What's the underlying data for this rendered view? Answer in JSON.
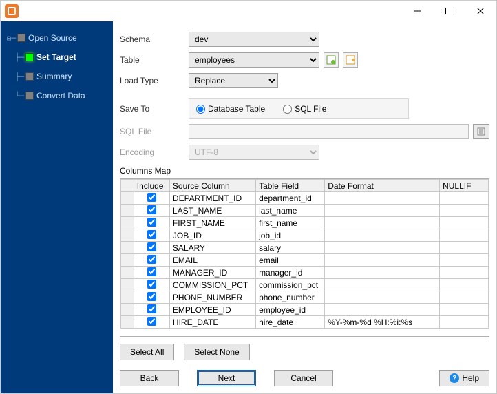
{
  "sidebar": {
    "items": [
      {
        "label": "Open Source",
        "active": false
      },
      {
        "label": "Set Target",
        "active": true
      },
      {
        "label": "Summary",
        "active": false
      },
      {
        "label": "Convert Data",
        "active": false
      }
    ]
  },
  "form": {
    "schema_label": "Schema",
    "schema_value": "dev",
    "table_label": "Table",
    "table_value": "employees",
    "loadtype_label": "Load Type",
    "loadtype_value": "Replace",
    "saveto_label": "Save To",
    "saveto_options": {
      "db": "Database Table",
      "sql": "SQL File"
    },
    "saveto_selected": "db",
    "sqlfile_label": "SQL File",
    "sqlfile_value": "",
    "encoding_label": "Encoding",
    "encoding_value": "UTF-8",
    "columns_label": "Columns Map"
  },
  "grid": {
    "headers": {
      "include": "Include",
      "source": "Source Column",
      "field": "Table Field",
      "date": "Date Format",
      "nullif": "NULLIF"
    },
    "rows": [
      {
        "include": true,
        "source": "DEPARTMENT_ID",
        "field": "department_id",
        "date": "",
        "nullif": ""
      },
      {
        "include": true,
        "source": "LAST_NAME",
        "field": "last_name",
        "date": "",
        "nullif": ""
      },
      {
        "include": true,
        "source": "FIRST_NAME",
        "field": "first_name",
        "date": "",
        "nullif": ""
      },
      {
        "include": true,
        "source": "JOB_ID",
        "field": "job_id",
        "date": "",
        "nullif": ""
      },
      {
        "include": true,
        "source": "SALARY",
        "field": "salary",
        "date": "",
        "nullif": ""
      },
      {
        "include": true,
        "source": "EMAIL",
        "field": "email",
        "date": "",
        "nullif": ""
      },
      {
        "include": true,
        "source": "MANAGER_ID",
        "field": "manager_id",
        "date": "",
        "nullif": ""
      },
      {
        "include": true,
        "source": "COMMISSION_PCT",
        "field": "commission_pct",
        "date": "",
        "nullif": ""
      },
      {
        "include": true,
        "source": "PHONE_NUMBER",
        "field": "phone_number",
        "date": "",
        "nullif": ""
      },
      {
        "include": true,
        "source": "EMPLOYEE_ID",
        "field": "employee_id",
        "date": "",
        "nullif": ""
      },
      {
        "include": true,
        "source": "HIRE_DATE",
        "field": "hire_date",
        "date": "%Y-%m-%d %H:%i:%s",
        "nullif": ""
      }
    ]
  },
  "buttons": {
    "select_all": "Select All",
    "select_none": "Select None",
    "back": "Back",
    "next": "Next",
    "cancel": "Cancel",
    "help": "Help"
  }
}
